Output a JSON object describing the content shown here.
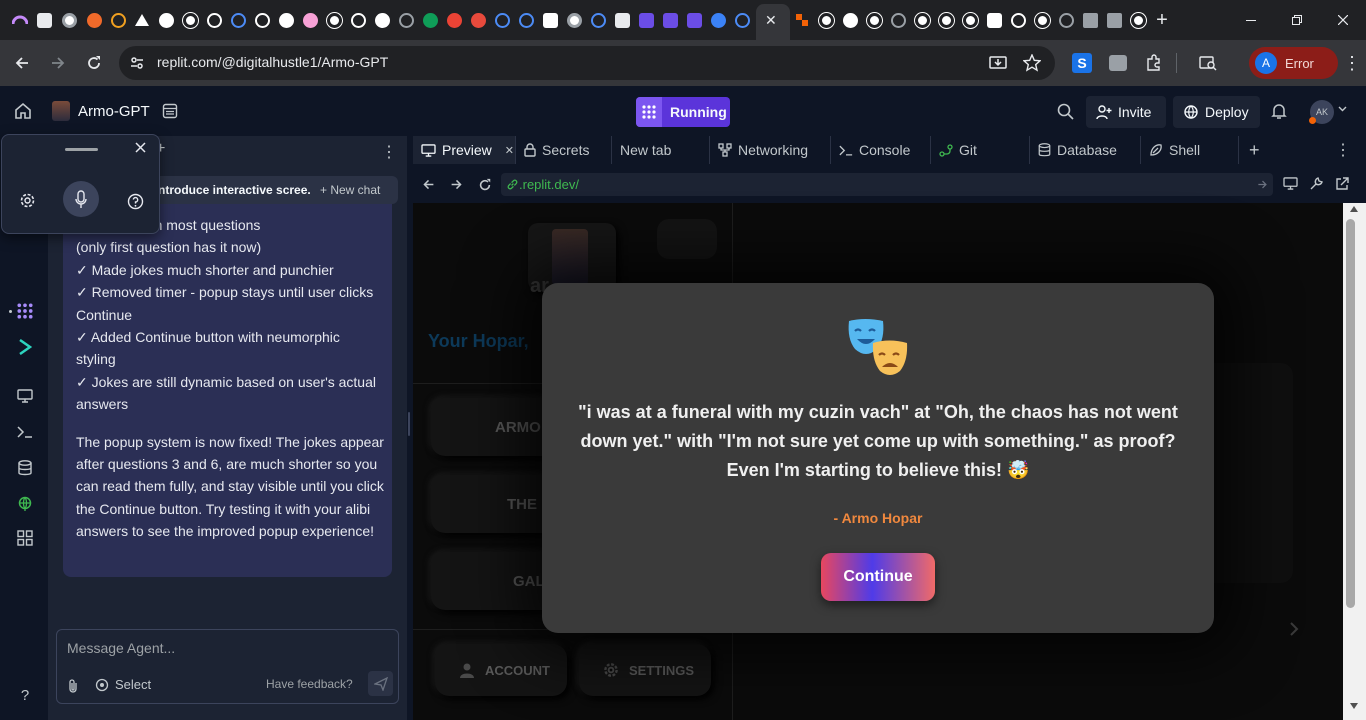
{
  "browser": {
    "active_tab_close": "✕",
    "new_tab": "+",
    "url": "replit.com/@digitalhustle1/Armo-GPT",
    "profile_initial": "A",
    "profile_status": "Error"
  },
  "replit": {
    "project_name": "Armo-GPT",
    "run_status": "Running",
    "invite_label": "Invite",
    "deploy_label": "Deploy",
    "user_initials": "AK"
  },
  "agent": {
    "chat_title": "ntroduce interactive scree...",
    "new_chat_label": "+ New chat",
    "message_lines": [
      "sername from most questions",
      "(only first question has it now)",
      "✓ Made jokes much shorter and punchier",
      "✓ Removed timer - popup stays until user clicks",
      "Continue",
      "✓ Added Continue button with neumorphic",
      "styling",
      "✓ Jokes are still dynamic based on user's actual",
      "answers"
    ],
    "summary": "The popup system is now fixed! The jokes appear after questions 3 and 6, are much shorter so you can read them fully, and stay visible until you click the Continue button. Try testing it with your alibi answers to see the improved popup experience!",
    "composer_placeholder": "Message Agent...",
    "select_label": "Select",
    "feedback_label": "Have feedback?"
  },
  "workspace": {
    "tabs": [
      {
        "label": "Preview"
      },
      {
        "label": "Secrets"
      },
      {
        "label": "New tab"
      },
      {
        "label": "Networking"
      },
      {
        "label": "Console"
      },
      {
        "label": "Git"
      },
      {
        "label": "Database"
      },
      {
        "label": "Shell"
      }
    ],
    "preview_url": ".replit.dev/"
  },
  "app": {
    "bg_title": "Your Hopar,",
    "bg_buttons": [
      "ARMO",
      "THE",
      "GAL"
    ],
    "bg_bottom": [
      "ACCOUNT",
      "SETTINGS"
    ],
    "bg_name": "ar",
    "modal": {
      "joke": "\"i was at a funeral with my cuzin vach\" at \"Oh, the chaos has not went down yet.\" with \"I'm not sure yet come up with something.\" as proof? Even I'm starting to believe this! 🤯",
      "author": "- Armo Hopar",
      "continue_label": "Continue"
    }
  },
  "colors": {
    "accent": "#5b34da",
    "agent_bubble": "#2b2f55",
    "author": "#f0883e",
    "profile_error": "#8c1d18"
  }
}
